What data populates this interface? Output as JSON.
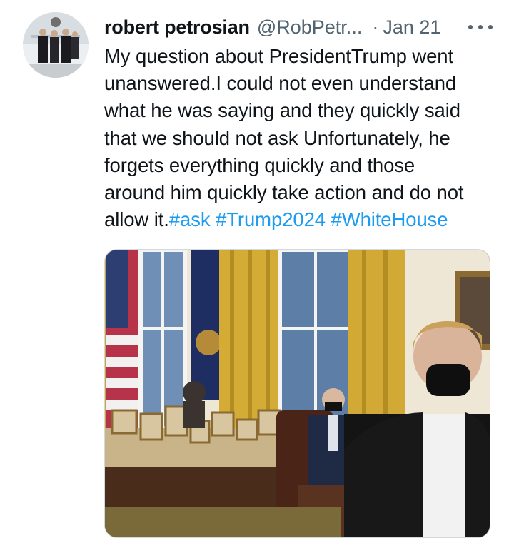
{
  "tweet": {
    "author": {
      "display_name": "robert petrosian",
      "handle": "@RobPetr...",
      "avatar_icon": "profile-photo"
    },
    "separator": "·",
    "date": "Jan 21",
    "more_icon": "more-horizontal-icon",
    "body_lines": [
      "My question about PresidentTrump went",
      "unanswered.I could not even understand",
      "what he was saying and they quickly said",
      "that we should not ask Unfortunately, he",
      "forgets everything quickly and those",
      "around him quickly take action and do not"
    ],
    "last_line_prefix": "allow it.",
    "hashtags": [
      "#ask",
      "#Trump2024",
      "#WhiteHouse"
    ],
    "media": {
      "type": "video-still"
    }
  },
  "colors": {
    "text": "#0f1419",
    "secondary": "#536471",
    "link": "#1d9bf0",
    "border": "#cfd9de"
  }
}
